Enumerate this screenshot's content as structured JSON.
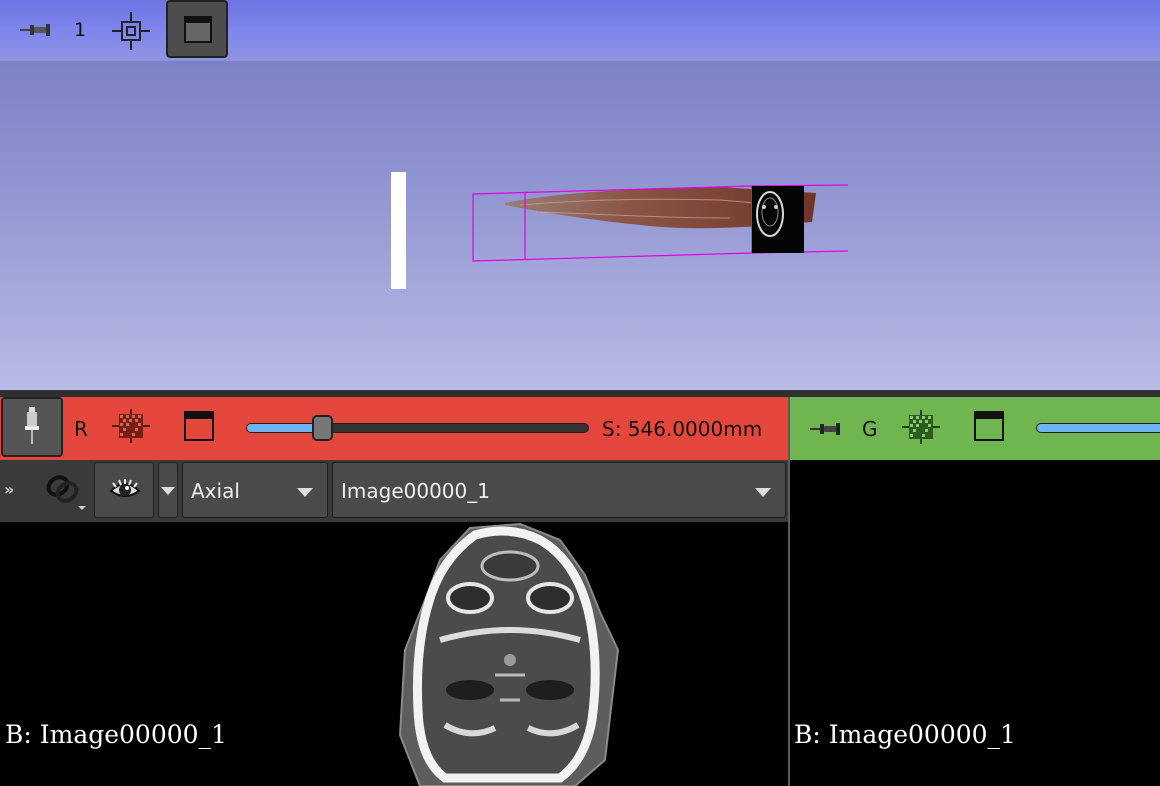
{
  "view3d": {
    "controller": {
      "view_number": "1",
      "icons": [
        "pin-icon",
        "center-view-icon",
        "maximize-view-icon"
      ]
    }
  },
  "red_view": {
    "label": "R",
    "offset": "S: 546.0000mm",
    "slider_position": 0.22,
    "orientation": "Axial",
    "volume": "Image00000_1",
    "background_annotation": "B: Image00000_1",
    "color": "#e5473c"
  },
  "green_view": {
    "label": "G",
    "background_annotation": "B: Image00000_1",
    "color": "#6fb650"
  },
  "colors": {
    "slider_fill": "#6fb4f0",
    "roi_box": "#e100e1"
  }
}
